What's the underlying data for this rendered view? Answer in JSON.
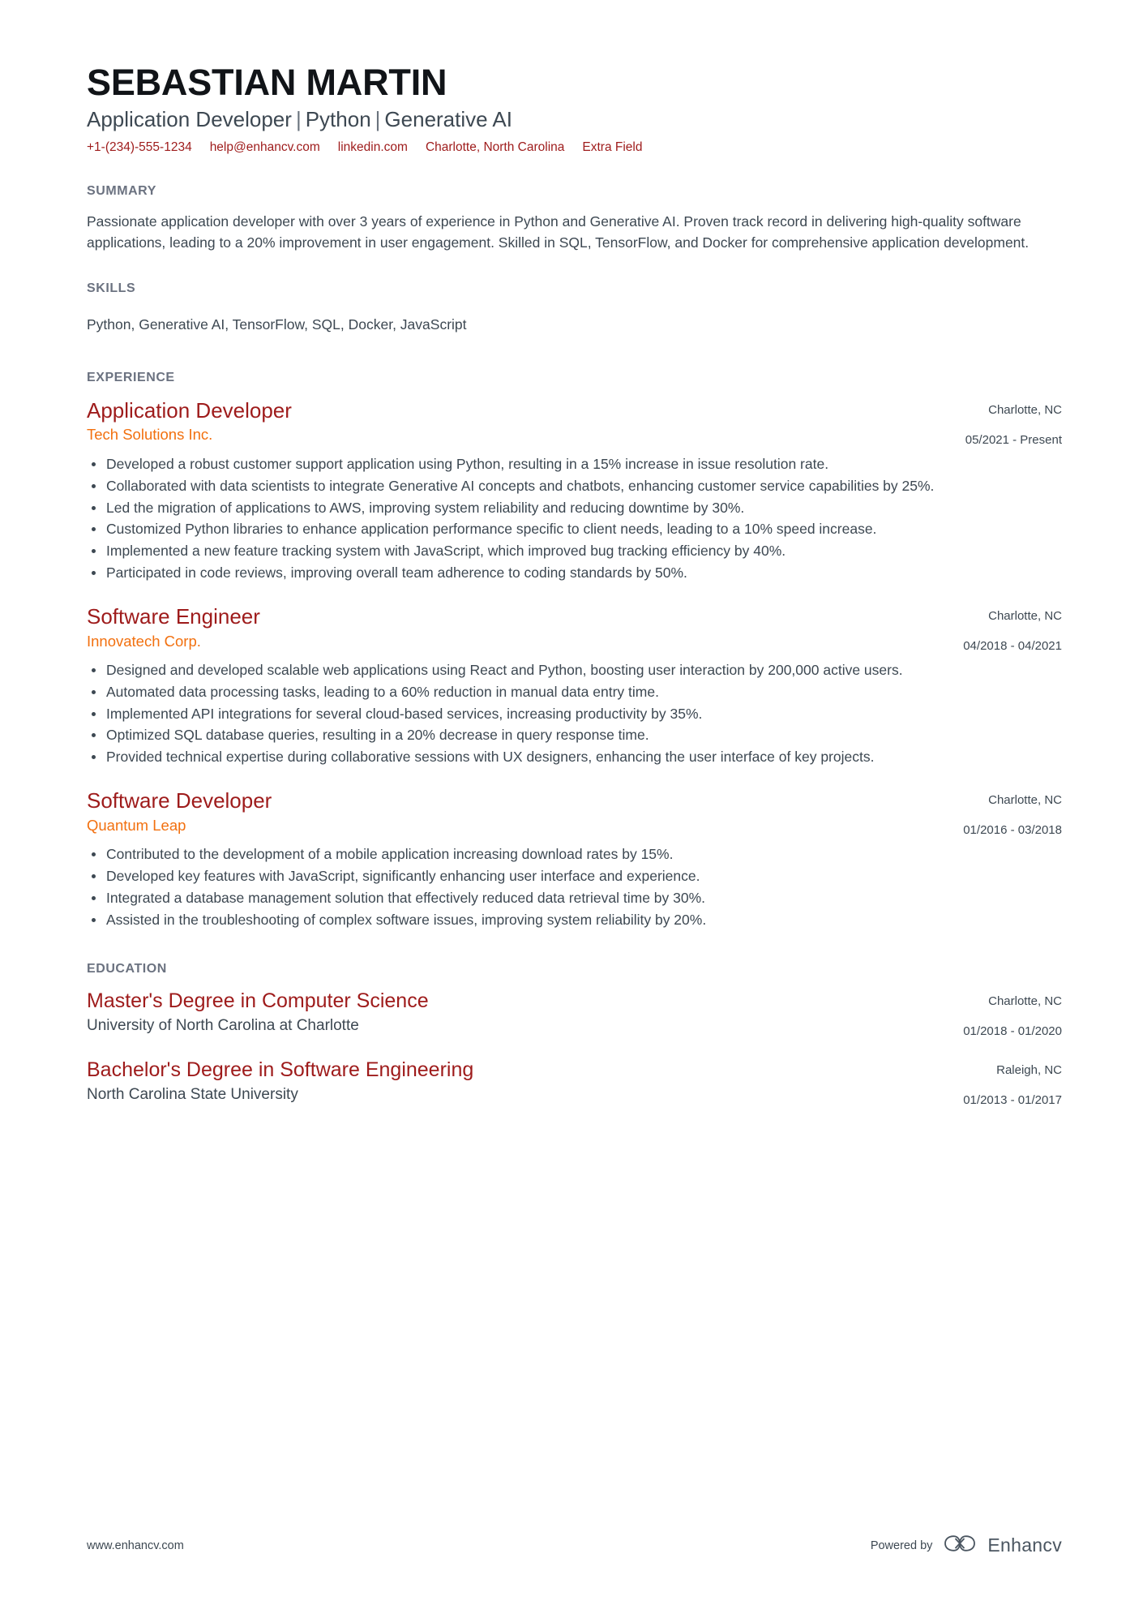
{
  "colors": {
    "name": "#111418",
    "accent_red": "#9e1b1b",
    "accent_orange": "#f2700f",
    "body_text": "#3d4852",
    "section_heading": "#6b7280",
    "background": "#ffffff"
  },
  "header": {
    "name": "SEBASTIAN MARTIN",
    "headline_parts": [
      "Application Developer",
      "Python",
      "Generative AI"
    ],
    "separator": "|",
    "contacts": [
      {
        "label": "+1-(234)-555-1234",
        "kind": "phone"
      },
      {
        "label": "help@enhancv.com",
        "kind": "email"
      },
      {
        "label": "linkedin.com",
        "kind": "link"
      },
      {
        "label": "Charlotte, North Carolina",
        "kind": "location"
      },
      {
        "label": "Extra Field",
        "kind": "extra"
      }
    ]
  },
  "summary": {
    "heading": "SUMMARY",
    "text": "Passionate application developer with over 3 years of experience in Python and Generative AI. Proven track record in delivering high-quality software applications, leading to a 20% improvement in user engagement. Skilled in SQL, TensorFlow, and Docker for comprehensive application development."
  },
  "skills": {
    "heading": "SKILLS",
    "text": "Python, Generative AI, TensorFlow, SQL, Docker, JavaScript"
  },
  "experience": {
    "heading": "EXPERIENCE",
    "entries": [
      {
        "title": "Application Developer",
        "company": "Tech Solutions Inc.",
        "location": "Charlotte, NC",
        "dates": "05/2021 - Present",
        "bullets": [
          "Developed a robust customer support application using Python, resulting in a 15% increase in issue resolution rate.",
          "Collaborated with data scientists to integrate Generative AI concepts and chatbots, enhancing customer service capabilities by 25%.",
          "Led the migration of applications to AWS, improving system reliability and reducing downtime by 30%.",
          "Customized Python libraries to enhance application performance specific to client needs, leading to a 10% speed increase.",
          "Implemented a new feature tracking system with JavaScript, which improved bug tracking efficiency by 40%.",
          "Participated in code reviews, improving overall team adherence to coding standards by 50%."
        ]
      },
      {
        "title": "Software Engineer",
        "company": "Innovatech Corp.",
        "location": "Charlotte, NC",
        "dates": "04/2018 - 04/2021",
        "bullets": [
          "Designed and developed scalable web applications using React and Python, boosting user interaction by 200,000 active users.",
          "Automated data processing tasks, leading to a 60% reduction in manual data entry time.",
          "Implemented API integrations for several cloud-based services, increasing productivity by 35%.",
          "Optimized SQL database queries, resulting in a 20% decrease in query response time.",
          "Provided technical expertise during collaborative sessions with UX designers, enhancing the user interface of key projects."
        ]
      },
      {
        "title": "Software Developer",
        "company": "Quantum Leap",
        "location": "Charlotte, NC",
        "dates": "01/2016 - 03/2018",
        "bullets": [
          "Contributed to the development of a mobile application increasing download rates by 15%.",
          "Developed key features with JavaScript, significantly enhancing user interface and experience.",
          "Integrated a database management solution that effectively reduced data retrieval time by 30%.",
          "Assisted in the troubleshooting of complex software issues, improving system reliability by 20%."
        ]
      }
    ]
  },
  "education": {
    "heading": "EDUCATION",
    "entries": [
      {
        "degree": "Master's Degree in Computer Science",
        "institution": "University of North Carolina at Charlotte",
        "location": "Charlotte, NC",
        "dates": "01/2018 - 01/2020"
      },
      {
        "degree": "Bachelor's Degree in Software Engineering",
        "institution": "North Carolina State University",
        "location": "Raleigh, NC",
        "dates": "01/2013 - 01/2017"
      }
    ]
  },
  "footer": {
    "url": "www.enhancv.com",
    "powered_by": "Powered by",
    "brand": "Enhancv"
  }
}
